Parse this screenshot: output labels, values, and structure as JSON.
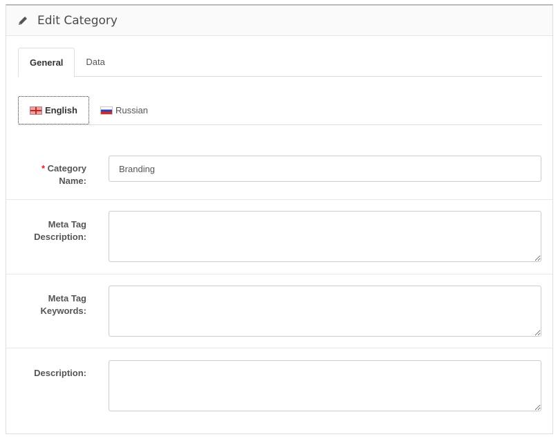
{
  "panel": {
    "title": "Edit Category",
    "title_icon": "pencil-icon"
  },
  "tabs": [
    {
      "label": "General",
      "active": true
    },
    {
      "label": "Data",
      "active": false
    }
  ],
  "languages": [
    {
      "label": "English",
      "flag": "english-flag-icon",
      "active": true
    },
    {
      "label": "Russian",
      "flag": "russian-flag-icon",
      "active": false
    }
  ],
  "form": {
    "category_name": {
      "required_mark": "*",
      "label": "Category Name:",
      "value": "Branding"
    },
    "meta_description": {
      "label": "Meta Tag Description:",
      "value": ""
    },
    "meta_keywords": {
      "label": "Meta Tag Keywords:",
      "value": ""
    },
    "description": {
      "label": "Description:",
      "value": ""
    }
  }
}
